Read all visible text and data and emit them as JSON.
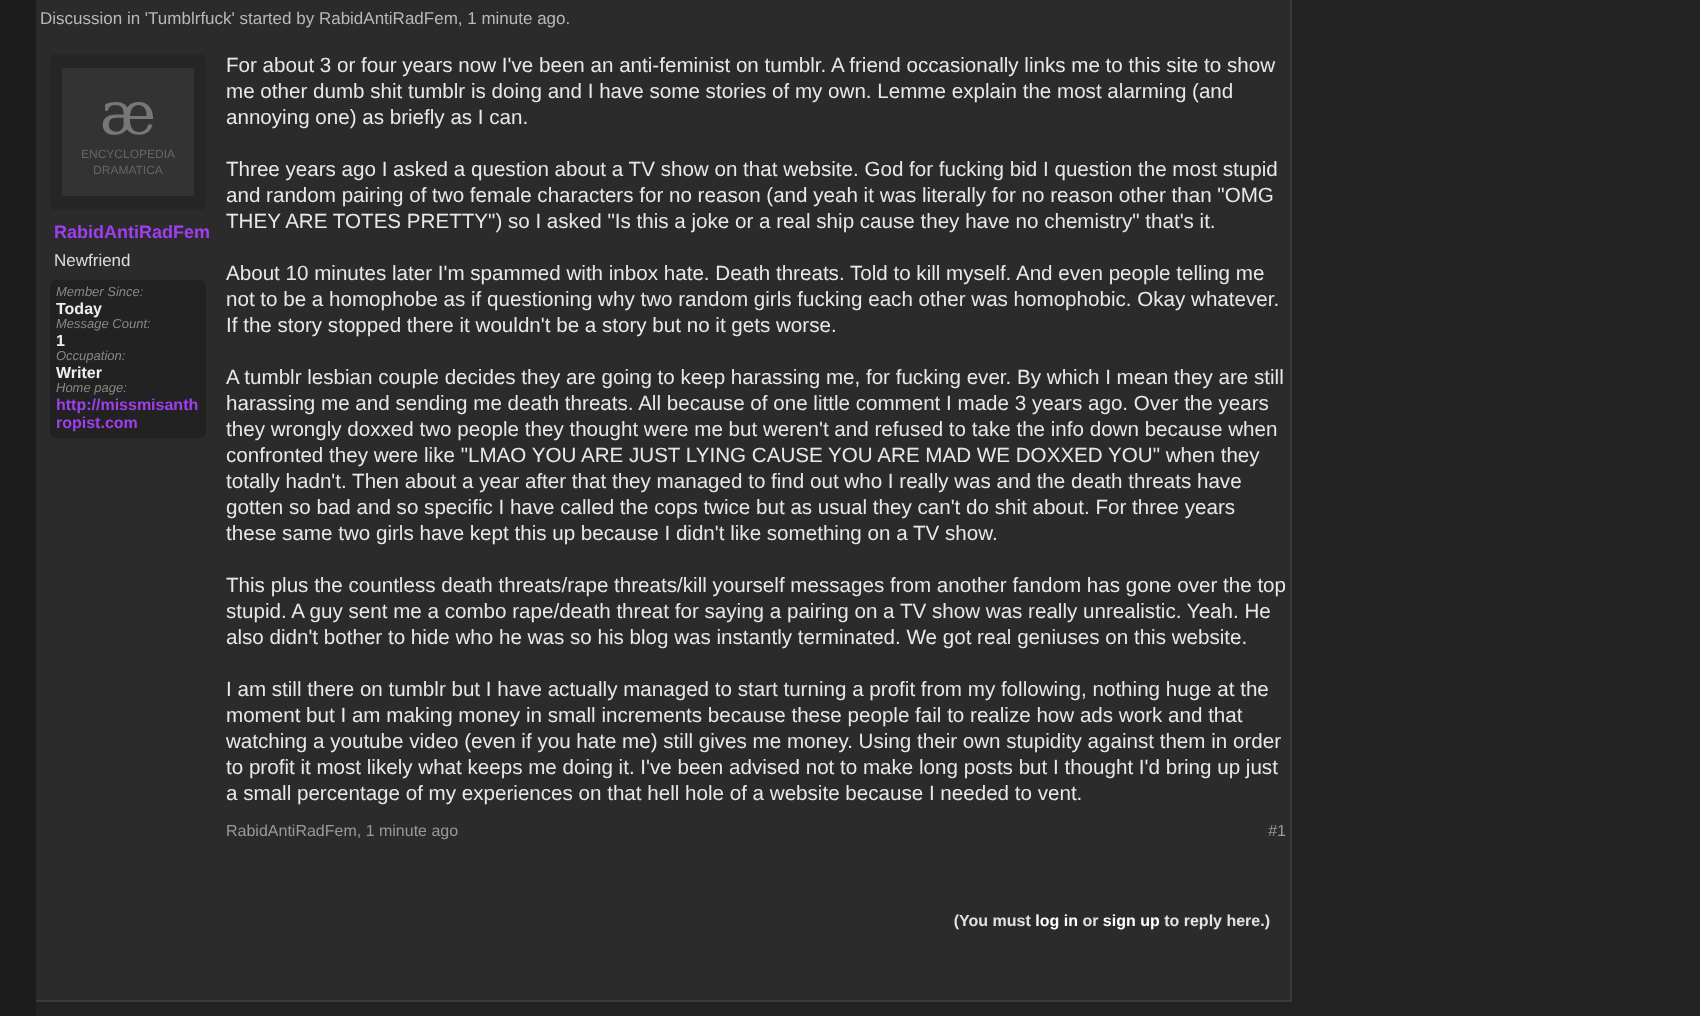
{
  "thread_info": {
    "parts": [
      "Discussion in '",
      "Tumblrfuck",
      "' started by ",
      "RabidAntiRadFem",
      ", 1 minute ago."
    ]
  },
  "author": {
    "avatar": {
      "symbol": "æ",
      "lines": [
        "ENCYCLOPEDIA",
        "DRAMATICA"
      ]
    },
    "name": "RabidAntiRadFem",
    "title": "Newfriend",
    "info": [
      {
        "label": "Member Since:",
        "value": "Today",
        "kind": "text"
      },
      {
        "label": "Message Count:",
        "value": "1",
        "kind": "text"
      },
      {
        "label": "Occupation:",
        "value": "Writer",
        "kind": "text"
      },
      {
        "label": "Home page:",
        "value": "http://missmisanthropist.com",
        "kind": "link"
      }
    ]
  },
  "post": {
    "paragraphs": [
      "For about 3 or four years now I've been an anti-feminist on tumblr. A friend occasionally links me to this site to show me other dumb shit tumblr is doing and I have some stories of my own. Lemme explain the most alarming (and annoying one) as briefly as I can.",
      "Three years ago I asked a question about a TV show on that website. God for fucking bid I question the most stupid and random pairing of two female characters for no reason (and yeah it was literally for no reason other than \"OMG THEY ARE TOTES PRETTY\") so I asked \"Is this a joke or a real ship cause they have no chemistry\" that's it.",
      "About 10 minutes later I'm spammed with inbox hate. Death threats. Told to kill myself. And even people telling me not to be a homophobe as if questioning why two random girls fucking each other was homophobic. Okay whatever. If the story stopped there it wouldn't be a story but no it gets worse.",
      "A tumblr lesbian couple decides they are going to keep harassing me, for fucking ever. By which I mean they are still harassing me and sending me death threats. All because of one little comment I made 3 years ago. Over the years they wrongly doxxed two people they thought were me but weren't and refused to take the info down because when confronted they were like \"LMAO YOU ARE JUST LYING CAUSE YOU ARE MAD WE DOXXED YOU\" when they totally hadn't. Then about a year after that they managed to find out who I really was and the death threats have gotten so bad and so specific I have called the cops twice but as usual they can't do shit about. For three years these same two girls have kept this up because I didn't like something on a TV show.",
      "This plus the countless death threats/rape threats/kill yourself messages from another fandom has gone over the top stupid. A guy sent me a combo rape/death threat for saying a pairing on a TV show was really unrealistic. Yeah. He also didn't bother to hide who he was so his blog was instantly terminated. We got real geniuses on this website.",
      "I am still there on tumblr but I have actually managed to start turning a profit from my following, nothing huge at the moment but I am making money in small increments because these people fail to realize how ads work and that watching a youtube video (even if you hate me) still gives me money. Using their own stupidity against them in order to profit it most likely what keeps me doing it. I've been advised not to make long posts but I thought I'd bring up just a small percentage of my experiences on that hell hole of a website because I needed to vent."
    ],
    "meta": {
      "author": "RabidAntiRadFem",
      "time": ", 1 minute ago"
    },
    "number": "#1"
  },
  "reply_note": {
    "parts": [
      {
        "text": "(You must ",
        "kind": "text"
      },
      {
        "text": "log in",
        "kind": "link"
      },
      {
        "text": " or ",
        "kind": "text"
      },
      {
        "text": "sign up",
        "kind": "link"
      },
      {
        "text": " to reply here.)",
        "kind": "text"
      }
    ]
  }
}
